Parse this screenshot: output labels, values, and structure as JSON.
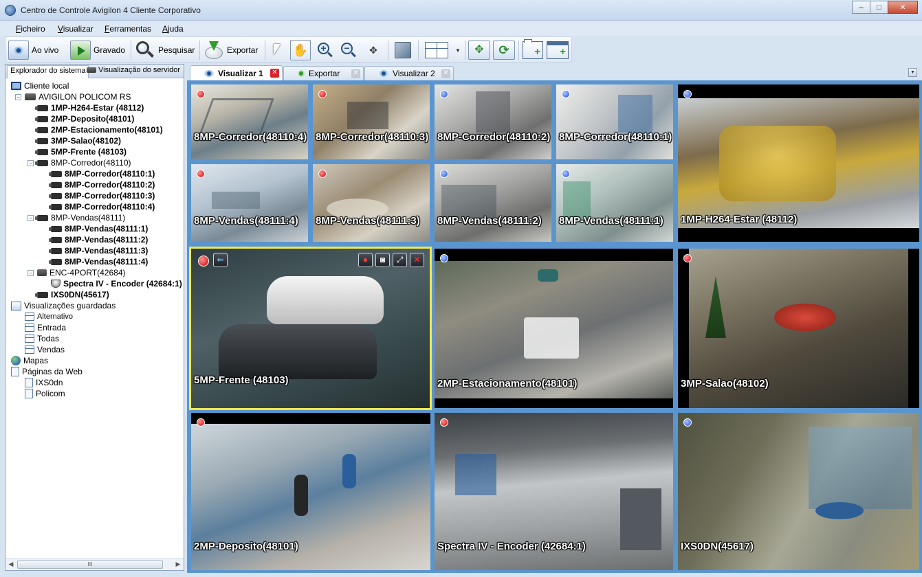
{
  "window": {
    "title": "Centro de Controle Avigilon 4 Cliente Corporativo",
    "minimize": "‒",
    "maximize": "□",
    "close": "✕"
  },
  "menu": [
    "Ficheiro",
    "Visualizar",
    "Ferramentas",
    "Ajuda"
  ],
  "toolbar": {
    "live": "Ao vivo",
    "recorded": "Gravado",
    "search": "Pesquisar",
    "export": "Exportar"
  },
  "left_panel": {
    "tabs": [
      "Explorador do sistema",
      "Visualização do servidor"
    ],
    "scroll_grip": "III",
    "scroll_left": "◀",
    "scroll_right": "▶",
    "tree": {
      "root": "Cliente local",
      "server": "AVIGILON POLICOM RS",
      "cameras_top": [
        "1MP-H264-Estar (48112)",
        "2MP-Deposito(48101)",
        "2MP-Estacionamento(48101)",
        "3MP-Salao(48102)",
        "5MP-Frente (48103)"
      ],
      "group_corredor": "8MP-Corredor(48110)",
      "corredor_items": [
        "8MP-Corredor(48110:1)",
        "8MP-Corredor(48110:2)",
        "8MP-Corredor(48110:3)",
        "8MP-Corredor(48110:4)"
      ],
      "group_vendas": "8MP-Vendas(48111)",
      "vendas_items": [
        "8MP-Vendas(48111:1)",
        "8MP-Vendas(48111:2)",
        "8MP-Vendas(48111:3)",
        "8MP-Vendas(48111:4)"
      ],
      "encoder": "ENC-4PORT(42684)",
      "encoder_item": "Spectra IV - Encoder (42684:1)",
      "ixs": "IXS0DN(45617)",
      "saved_views": "Visualizações guardadas",
      "views": [
        "Alternativo",
        "Entrada",
        "Todas",
        "Vendas"
      ],
      "maps": "Mapas",
      "web_pages": "Páginas da Web",
      "pages": [
        "IXS0dn",
        "Policom"
      ]
    }
  },
  "view_tabs": [
    {
      "label": "Visualizar 1",
      "active": true
    },
    {
      "label": "Exportar",
      "active": false
    },
    {
      "label": "Visualizar 2",
      "active": false
    }
  ],
  "tiles": {
    "corredor_4": "8MP-Corredor(48110:4)",
    "corredor_3": "8MP-Corredor(48110:3)",
    "corredor_2": "8MP-Corredor(48110:2)",
    "corredor_1": "8MP-Corredor(48110:1)",
    "estar": "1MP-H264-Estar (48112)",
    "vendas_4": "8MP-Vendas(48111:4)",
    "vendas_3": "8MP-Vendas(48111:3)",
    "vendas_2": "8MP-Vendas(48111:2)",
    "vendas_1": "8MP-Vendas(48111:1)",
    "frente": "5MP-Frente (48103)",
    "estacionamento": "2MP-Estacionamento(48101)",
    "salao": "3MP-Salao(48102)",
    "deposito": "2MP-Deposito(48101)",
    "spectra": "Spectra IV - Encoder (42684:1)",
    "ixs": "IXS0DN(45617)"
  },
  "colors": {
    "tile_border": "#5b95cf",
    "selected_border": "#f1e94b",
    "recording_dot": "#d80000",
    "idle_dot": "#1f4dd8"
  }
}
